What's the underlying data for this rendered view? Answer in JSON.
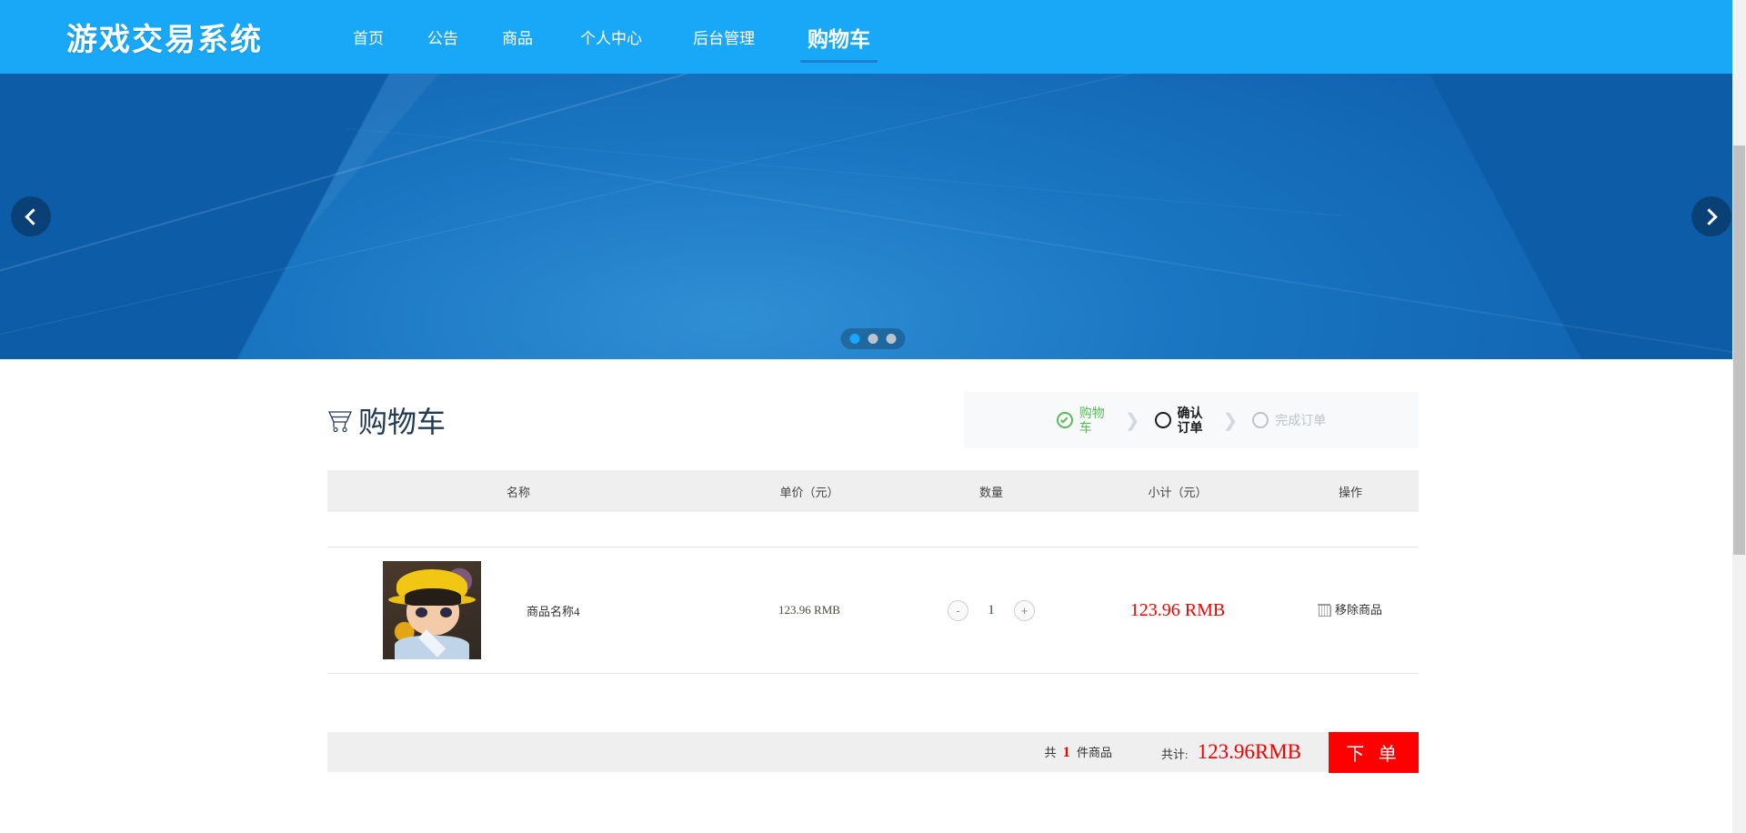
{
  "nav": {
    "brand": "游戏交易系统",
    "items": [
      {
        "label": "首页",
        "active": false
      },
      {
        "label": "公告",
        "active": false
      },
      {
        "label": "商品",
        "active": false
      },
      {
        "label": "个人中心",
        "active": false
      },
      {
        "label": "后台管理",
        "active": false
      },
      {
        "label": "购物车",
        "active": true
      }
    ],
    "bg_color": "#18a8f7"
  },
  "banner": {
    "prev_label": "‹",
    "next_label": "›",
    "dots": [
      "1",
      "2",
      "3"
    ],
    "active_dot": 1
  },
  "cart": {
    "title": "购物车",
    "steps": [
      {
        "label": "购物车",
        "state": "done"
      },
      {
        "label": "确认订单",
        "state": "current"
      },
      {
        "label": "完成订单",
        "state": "todo"
      }
    ],
    "step_separator": "❯",
    "columns": {
      "name": "名称",
      "price": "单价（元）",
      "qty": "数量",
      "subtotal": "小计（元）",
      "action": "操作"
    },
    "rows": [
      {
        "name": "商品名称4",
        "price": "123.96 RMB",
        "qty": "1",
        "minus": "-",
        "plus": "+",
        "subtotal": "123.96 RMB",
        "remove_label": "移除商品"
      }
    ],
    "footer": {
      "count_prefix": "共",
      "count": "1",
      "count_suffix": "件商品",
      "total_label": "共计:",
      "total_amount": "123.96RMB",
      "order_button": "下 单"
    },
    "accent_red": "#f60000",
    "header_bg": "#efefef"
  }
}
